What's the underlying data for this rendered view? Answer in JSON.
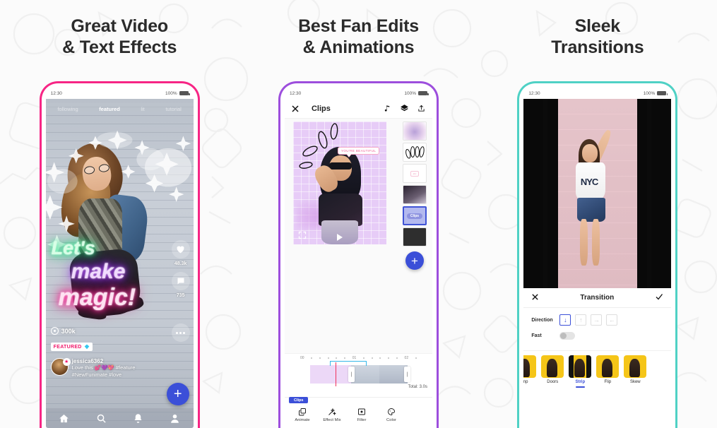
{
  "panels": [
    {
      "title": "Great Video\n& Text Effects",
      "frame_color": "#f72585",
      "statusbar": {
        "time": "12:30",
        "battery_pct": "100%"
      },
      "feed": {
        "tabs": [
          {
            "label": "following",
            "active": false
          },
          {
            "label": "featured",
            "active": true
          },
          {
            "label": "lit",
            "active": false
          },
          {
            "label": "tutorial",
            "active": false
          }
        ],
        "neon_text": [
          "Let's",
          "make",
          "magic!"
        ],
        "likes": "48.3k",
        "comments": "735",
        "views": "300k",
        "badge": "FEATURED",
        "badge_icon": "diamond-icon",
        "username": "jessica6362",
        "caption_line1": "Love this 💕💜💖 #feature",
        "caption_line2": "#NewFunimate #love",
        "fab_label": "+",
        "nav": [
          "home-icon",
          "search-icon",
          "bell-icon",
          "profile-icon"
        ]
      }
    },
    {
      "title": "Best Fan Edits\n& Animations",
      "frame_color": "#9d4edd",
      "statusbar": {
        "time": "12:30",
        "battery_pct": "100%"
      },
      "editor": {
        "header": {
          "close_icon": "close-icon",
          "title": "Clips",
          "music_icon": "music-note-icon",
          "layers_icon": "layers-icon",
          "share_icon": "share-icon"
        },
        "canvas": {
          "bubble_text": "YOU'RE BEAUTIFUL"
        },
        "layers": [
          {
            "name": "smoke-layer",
            "type": "image"
          },
          {
            "name": "doodle-layer",
            "type": "image"
          },
          {
            "name": "bubble-layer",
            "type": "image"
          },
          {
            "name": "photo-layer",
            "type": "image"
          },
          {
            "name": "clips-layer",
            "type": "chip",
            "chip": "Clips",
            "selected": true
          },
          {
            "name": "background-layer",
            "type": "black"
          }
        ],
        "add_layer_label": "+",
        "timeline": {
          "marks": [
            "00",
            "01",
            "02"
          ],
          "total": "Total: 3.0s"
        },
        "active_tool_tag": "Clips",
        "tools": [
          {
            "label": "Animate",
            "icon": "copy-icon"
          },
          {
            "label": "Effect Mix",
            "icon": "magic-wand-icon"
          },
          {
            "label": "Filter",
            "icon": "filter-icon"
          },
          {
            "label": "Color",
            "icon": "palette-icon"
          }
        ]
      }
    },
    {
      "title": "Sleek\nTransitions",
      "frame_color": "#4fd1c5",
      "statusbar": {
        "time": "12:30",
        "battery_pct": "100%"
      },
      "transition": {
        "header": {
          "close_icon": "close-icon",
          "title": "Transition",
          "confirm_icon": "check-icon"
        },
        "direction_label": "Direction",
        "directions": [
          {
            "name": "down-arrow",
            "glyph": "↓",
            "selected": true
          },
          {
            "name": "up-arrow",
            "glyph": "↑",
            "selected": false
          },
          {
            "name": "right-arrow",
            "glyph": "→",
            "selected": false
          },
          {
            "name": "left-arrow",
            "glyph": "←",
            "selected": false
          }
        ],
        "fast_label": "Fast",
        "fast_on": false,
        "shirt_text": "NYC",
        "effects": [
          {
            "label": "mp",
            "selected": false
          },
          {
            "label": "Doors",
            "selected": false
          },
          {
            "label": "Strip",
            "selected": true
          },
          {
            "label": "Flip",
            "selected": false
          },
          {
            "label": "Skew",
            "selected": false
          }
        ]
      }
    }
  ]
}
